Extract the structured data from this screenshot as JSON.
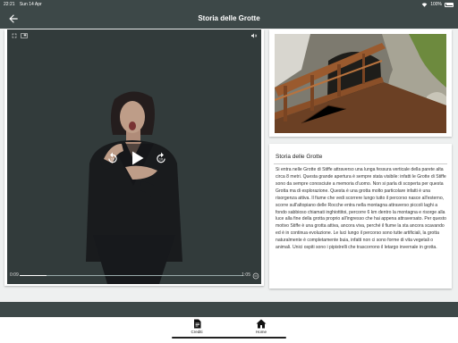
{
  "status_bar": {
    "time": "22:21",
    "date": "Sun 14 Apr",
    "battery": "100%"
  },
  "app_bar": {
    "title": "Storia delle Grotte",
    "back_icon": "arrow-back-icon"
  },
  "video_player": {
    "current_time": "0:09",
    "duration": "1:05",
    "progress": 0.12,
    "rewind_label": "10",
    "forward_label": "10",
    "icons": [
      "fullscreen-icon",
      "picture-in-picture-icon",
      "volume-icon",
      "play-icon",
      "replay-10-icon",
      "forward-10-icon",
      "more-icon"
    ]
  },
  "article": {
    "title": "Storia delle Grotte",
    "body": "Si entra nelle Grotte di Stiffe attraverso una lunga fessura verticale della parete alta circa 8 metri. Questa grande apertura è sempre stata visibile: infatti le Grotte di Stiffe sono da sempre conosciute a memoria d'uomo. Non si parla di scoperta per questa Grotta ma di esplorazione. Questa è una grotta molto particolare infatti è una risorgenza attiva. Il fiume che vedi scorrere lungo tutto il percorso nasce all'esterno, scorre sull'altopiano delle Rocche entra nella montagna attraverso piccoli laghi a fondo sabbioso chiamati inghiottitoi, percorre 6 km dentro la montagna e risorge alla luce alla fine della grotta proprio all'ingresso che hai appena attraversato. Per questo motivo Stiffe è una grotta attiva, ancora viva, perché il fiume la sta ancora scavando ed è in continua evoluzione. Le luci lungo il percorso sono tutte artificiali, la grotta naturalmente è completamente buia, infatti non ci sono forme di vita vegetali o animali. Unici ospiti sono i pipistrelli che trascorrono il letargo invernale in grotta."
  },
  "bottom_nav": {
    "items": [
      {
        "label": "Crediti",
        "icon": "document-icon"
      },
      {
        "label": "Home",
        "icon": "home-icon"
      }
    ]
  },
  "colors": {
    "bar": "#3d4848",
    "background": "#eef0f0",
    "video_bg": "#3a4444"
  }
}
